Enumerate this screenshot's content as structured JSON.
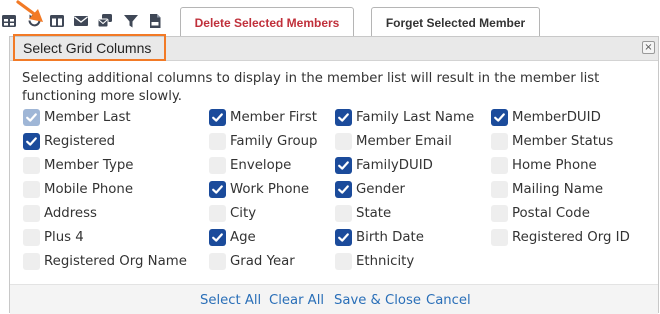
{
  "toolbar": {
    "icons": [
      "grid-icon",
      "refresh-icon",
      "columns-icon",
      "email-icon",
      "messages-icon",
      "filter-icon",
      "export-icon"
    ],
    "delete_label": "Delete Selected Members",
    "forget_label": "Forget Selected Member",
    "delete_color": "#c0303b"
  },
  "dialog": {
    "title": "Select Grid Columns",
    "close_glyph": "×",
    "message": "Selecting additional columns to display in the member list will result in the member list functioning more slowly.",
    "highlight_color": "#f27a26",
    "checkbox_checked_color": "#1b4b9b",
    "columns": [
      [
        {
          "label": "Member Last",
          "state": "checked-disabled"
        },
        {
          "label": "Registered",
          "state": "checked"
        },
        {
          "label": "Member Type",
          "state": "unchecked"
        },
        {
          "label": "Mobile Phone",
          "state": "unchecked"
        },
        {
          "label": "Address",
          "state": "unchecked"
        },
        {
          "label": "Plus 4",
          "state": "unchecked"
        },
        {
          "label": "Registered Org Name",
          "state": "unchecked"
        }
      ],
      [
        {
          "label": "Member First",
          "state": "checked"
        },
        {
          "label": "Family Group",
          "state": "unchecked"
        },
        {
          "label": "Envelope",
          "state": "unchecked"
        },
        {
          "label": "Work Phone",
          "state": "checked"
        },
        {
          "label": "City",
          "state": "unchecked"
        },
        {
          "label": "Age",
          "state": "checked"
        },
        {
          "label": "Grad Year",
          "state": "unchecked"
        }
      ],
      [
        {
          "label": "Family Last Name",
          "state": "checked"
        },
        {
          "label": "Member Email",
          "state": "unchecked"
        },
        {
          "label": "FamilyDUID",
          "state": "checked"
        },
        {
          "label": "Gender",
          "state": "checked"
        },
        {
          "label": "State",
          "state": "unchecked"
        },
        {
          "label": "Birth Date",
          "state": "checked"
        },
        {
          "label": "Ethnicity",
          "state": "unchecked"
        }
      ],
      [
        {
          "label": "MemberDUID",
          "state": "checked"
        },
        {
          "label": "Member Status",
          "state": "unchecked"
        },
        {
          "label": "Home Phone",
          "state": "unchecked"
        },
        {
          "label": "Mailing Name",
          "state": "unchecked"
        },
        {
          "label": "Postal Code",
          "state": "unchecked"
        },
        {
          "label": "Registered Org ID",
          "state": "unchecked"
        }
      ]
    ],
    "footer": {
      "select_all": "Select All",
      "clear_all": "Clear All",
      "save_close": "Save & Close",
      "cancel": "Cancel"
    }
  }
}
